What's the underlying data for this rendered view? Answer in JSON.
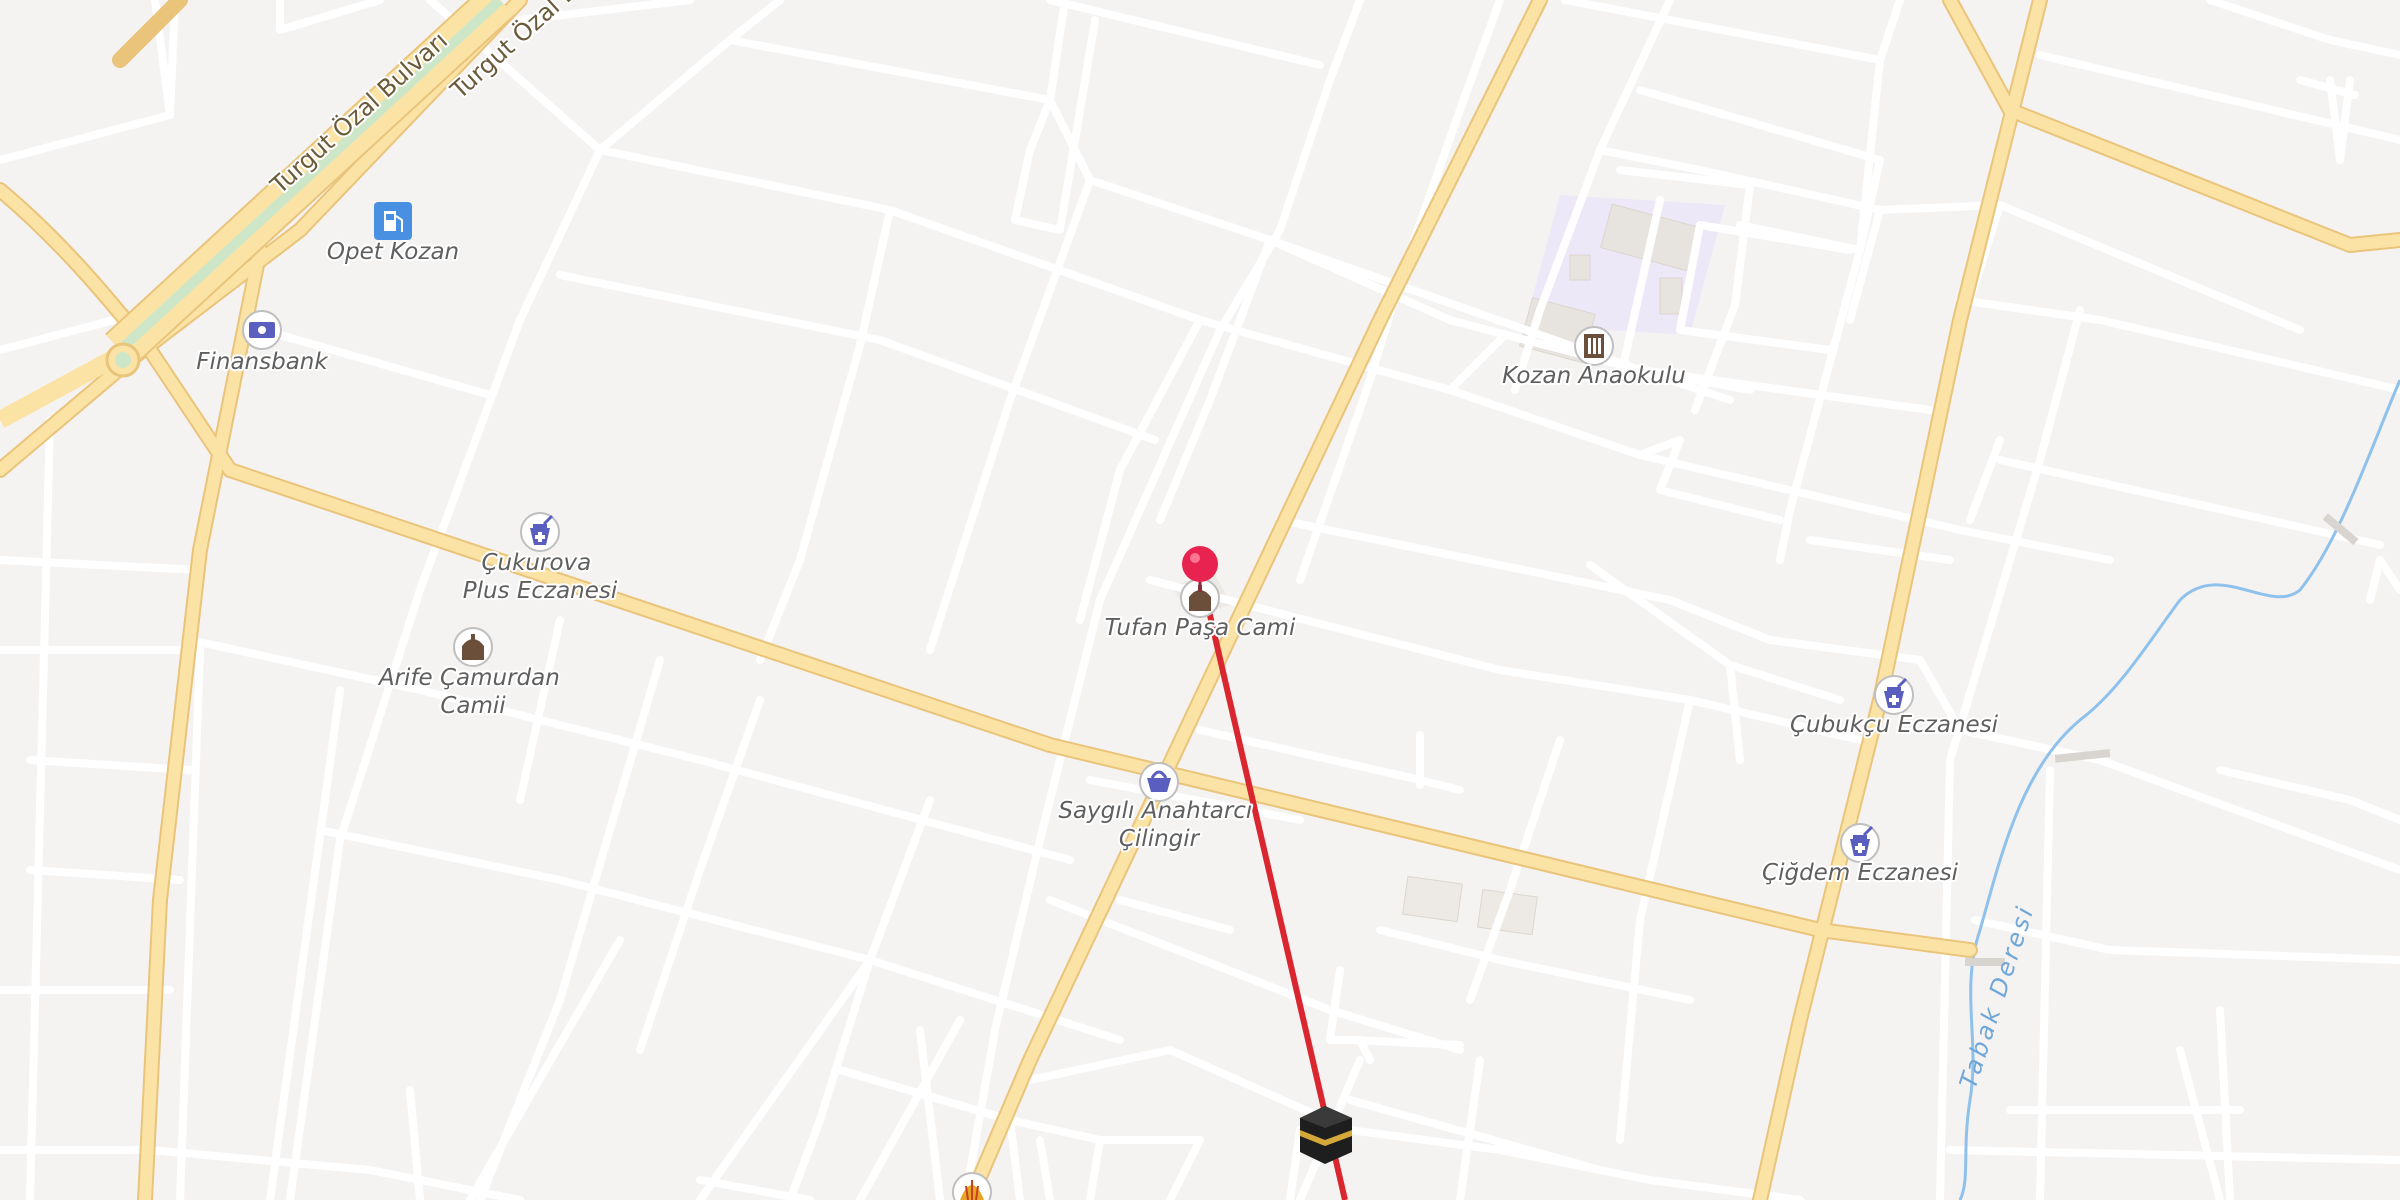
{
  "map": {
    "roads": [
      {
        "name": "turgut-ozal-bulvari-1",
        "label": "Turgut Özal Bulvarı"
      },
      {
        "name": "turgut-ozal-bulvari-2",
        "label": "Turgut Özal B"
      }
    ],
    "waterways": [
      {
        "name": "tabak-deresi",
        "label": "Tabak Deresi"
      }
    ],
    "pois": [
      {
        "id": "opet-kozan",
        "label": "Opet Kozan",
        "icon": "fuel-icon"
      },
      {
        "id": "finansbank",
        "label": "Finansbank",
        "icon": "bank-icon"
      },
      {
        "id": "cukurova-plus-eczanesi",
        "label": "Çukurova\nPlus Eczanesi",
        "icon": "pharmacy-icon"
      },
      {
        "id": "arife-camurdan-camii",
        "label": "Arife Çamurdan\nCamii",
        "icon": "mosque-icon"
      },
      {
        "id": "tufan-pasa-cami",
        "label": "Tufan Paşa Cami",
        "icon": "mosque-icon"
      },
      {
        "id": "saygili-anahtarci",
        "label": "Saygılı Anahtarcı\nÇilingir",
        "icon": "shopping-basket-icon"
      },
      {
        "id": "kozan-anaokulu",
        "label": "Kozan Anaokulu",
        "icon": "school-icon"
      },
      {
        "id": "cubukcu-eczanesi",
        "label": "Çubukçu Eczanesi",
        "icon": "pharmacy-icon"
      },
      {
        "id": "cigdem-eczanesi",
        "label": "Çiğdem Eczanesi",
        "icon": "pharmacy-icon"
      }
    ],
    "markers": [
      {
        "id": "location-pin",
        "icon": "map-pin-icon",
        "color": "#e8234f"
      },
      {
        "id": "qibla-kaaba",
        "icon": "kaaba-icon"
      },
      {
        "id": "shell-station",
        "icon": "shell-icon"
      }
    ],
    "qibla_line_color": "#d9262f",
    "colors": {
      "background": "#f5f3f1",
      "minor_road": "#ffffff",
      "major_road": "#fbe3a6",
      "major_road_casing": "#e9c47a",
      "water": "#8ec1ec",
      "school_area": "#ece8f8",
      "poi_icon": "#5a5fbf"
    }
  }
}
